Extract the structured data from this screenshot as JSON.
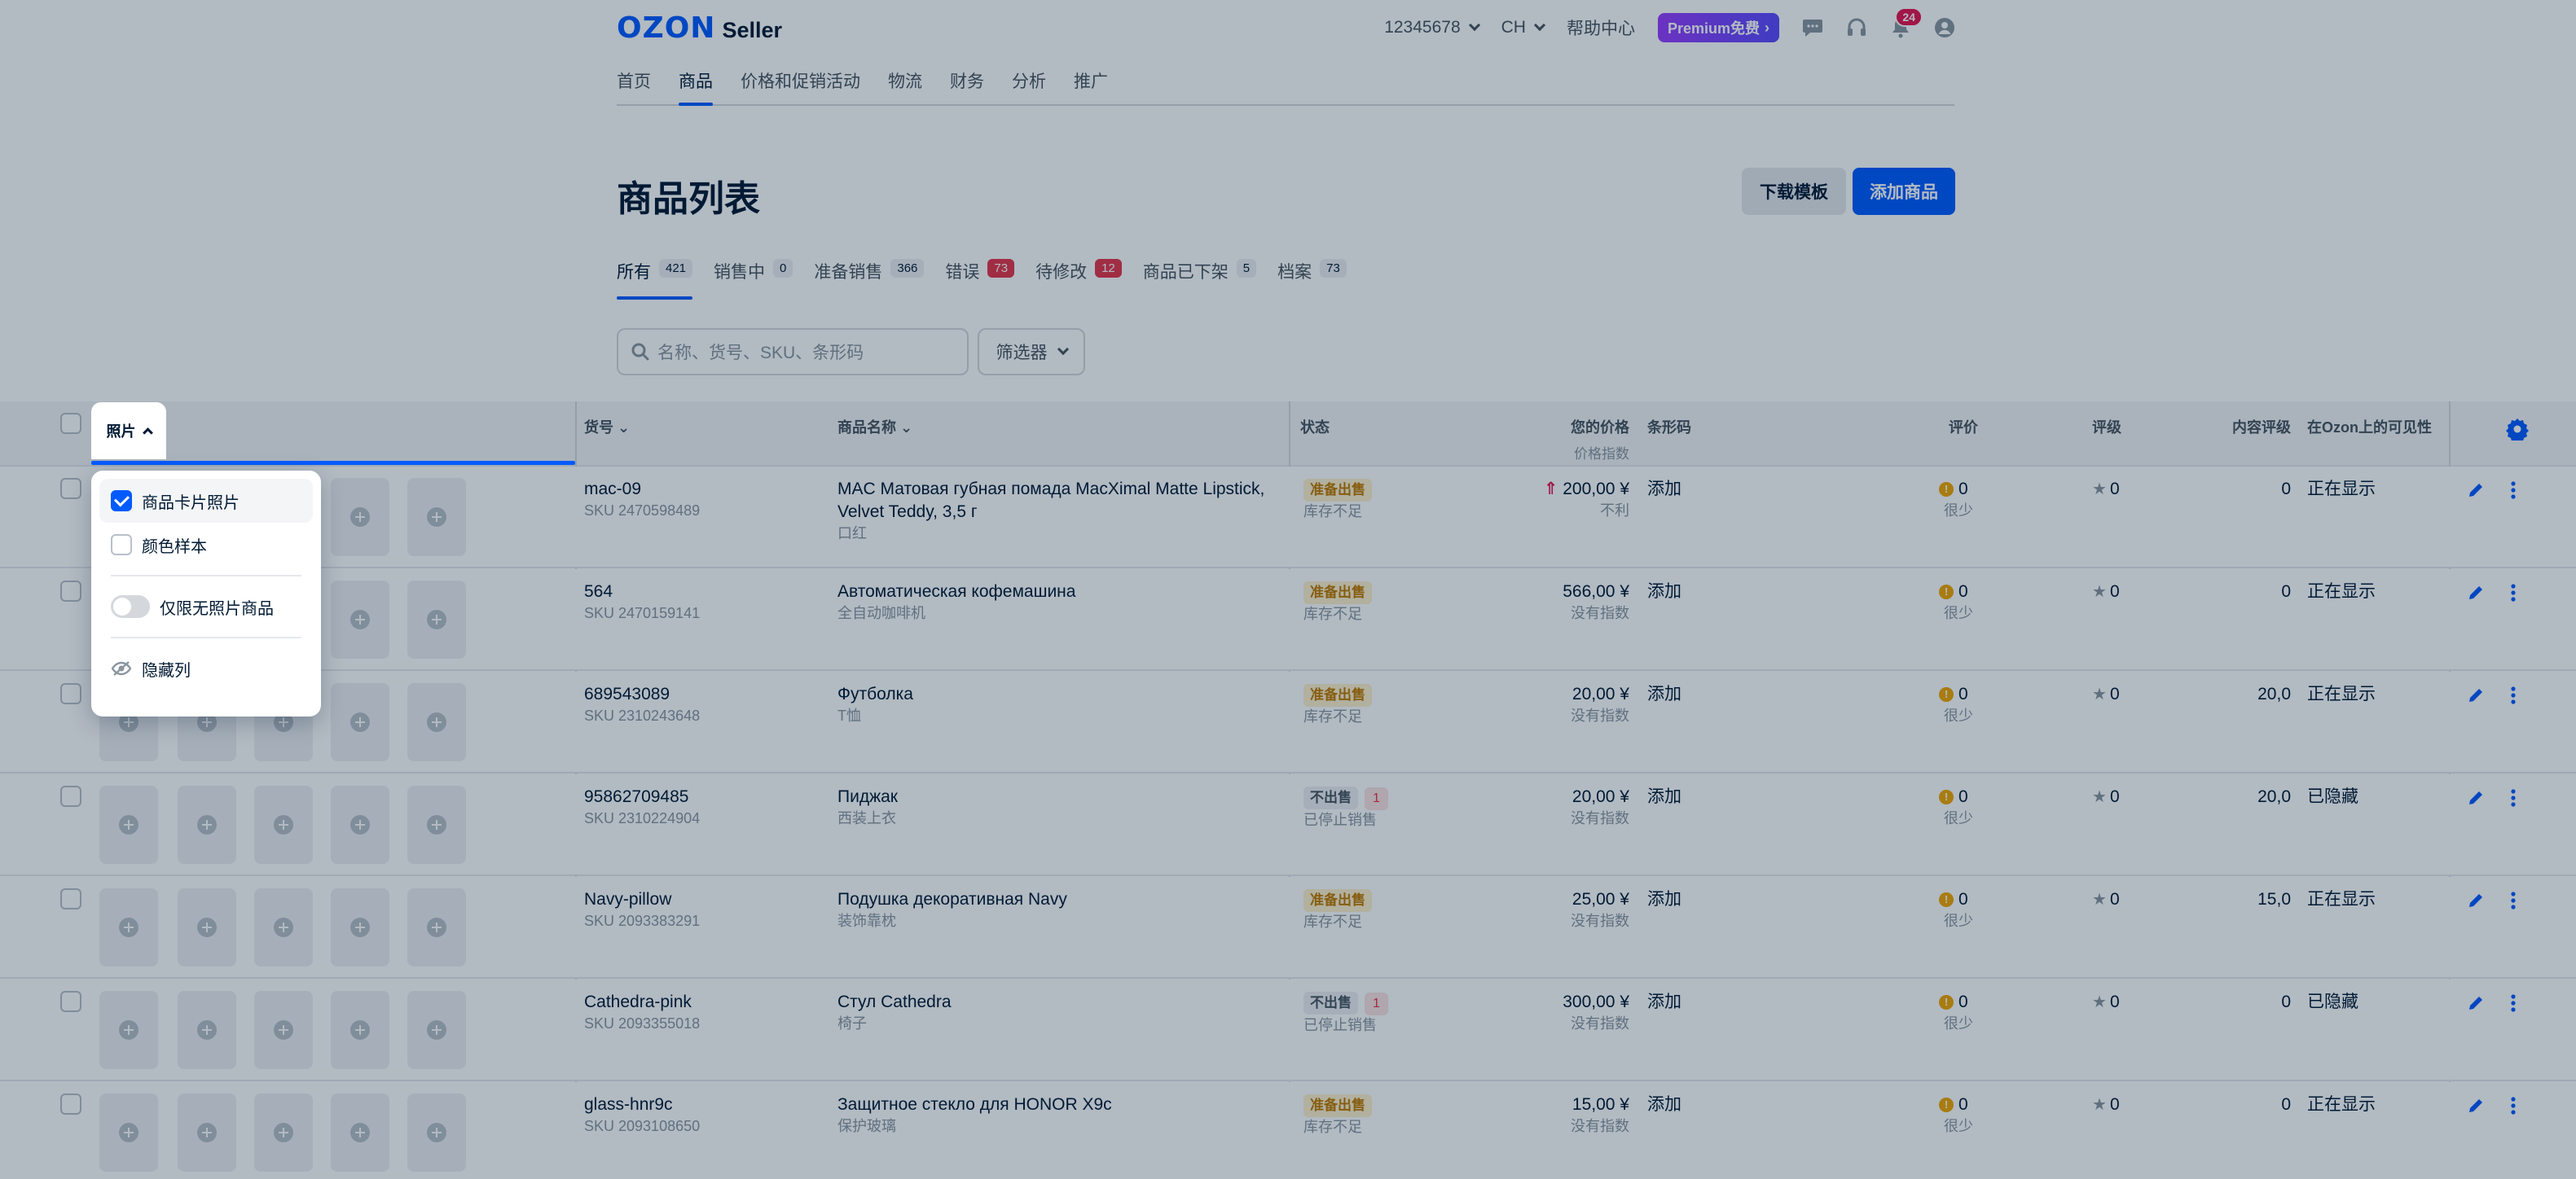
{
  "header": {
    "logo_brand": "OZON",
    "logo_product": "Seller",
    "account_id": "12345678",
    "region": "CH",
    "help": "帮助中心",
    "premium": "Premium免费",
    "notifications_count": "24"
  },
  "nav": [
    "首页",
    "商品",
    "价格和促销活动",
    "物流",
    "财务",
    "分析",
    "推广"
  ],
  "page": {
    "title": "商品列表",
    "download_template": "下载模板",
    "add_product": "添加商品"
  },
  "tabs": [
    {
      "label": "所有",
      "count": "421"
    },
    {
      "label": "销售中",
      "count": "0"
    },
    {
      "label": "准备销售",
      "count": "366"
    },
    {
      "label": "错误",
      "count": "73"
    },
    {
      "label": "待修改",
      "count": "12"
    },
    {
      "label": "商品已下架",
      "count": "5"
    },
    {
      "label": "档案",
      "count": "73"
    }
  ],
  "search": {
    "placeholder": "名称、货号、SKU、条形码",
    "filter": "筛选器"
  },
  "columns": {
    "photo": "照片",
    "sku": "货号",
    "name": "商品名称",
    "status": "状态",
    "price": "您的价格",
    "price_sub": "价格指数",
    "barcode": "条形码",
    "rating": "评价",
    "grade": "评级",
    "content": "内容评级",
    "visibility": "在Ozon上的可见性"
  },
  "dropdown": {
    "card_photo": "商品卡片照片",
    "color_sample": "颜色样本",
    "only_no_photo": "仅限无照片商品",
    "hide_column": "隐藏列"
  },
  "rows": [
    {
      "code": "mac-09",
      "sku": "SKU 2470598489",
      "name": "MAC Матовая губная помада MacXimal Matte Lipstick, Velvet Teddy, 3,5 г",
      "name_cn": "口红",
      "status": "准备出售",
      "status_sub": "库存不足",
      "status_num": "",
      "price": "200,00 ¥",
      "price_index": "不利",
      "barcode": "添加",
      "rating": "0",
      "rating_sub": "很少",
      "grade": "0",
      "content": "0",
      "visibility": "正在显示"
    },
    {
      "code": "564",
      "sku": "SKU 2470159141",
      "name": "Автоматическая кофемашина",
      "name_cn": "全自动咖啡机",
      "status": "准备出售",
      "status_sub": "库存不足",
      "status_num": "",
      "price": "566,00 ¥",
      "price_index": "没有指数",
      "barcode": "添加",
      "rating": "0",
      "rating_sub": "很少",
      "grade": "0",
      "content": "0",
      "visibility": "正在显示"
    },
    {
      "code": "689543089",
      "sku": "SKU 2310243648",
      "name": "Футболка",
      "name_cn": "T恤",
      "status": "准备出售",
      "status_sub": "库存不足",
      "status_num": "",
      "price": "20,00 ¥",
      "price_index": "没有指数",
      "barcode": "添加",
      "rating": "0",
      "rating_sub": "很少",
      "grade": "0",
      "content": "20,0",
      "visibility": "正在显示"
    },
    {
      "code": "95862709485",
      "sku": "SKU 2310224904",
      "name": "Пиджак",
      "name_cn": "西装上衣",
      "status": "不出售",
      "status_sub": "已停止销售",
      "status_num": "1",
      "price": "20,00 ¥",
      "price_index": "没有指数",
      "barcode": "添加",
      "rating": "0",
      "rating_sub": "很少",
      "grade": "0",
      "content": "20,0",
      "visibility": "已隐藏"
    },
    {
      "code": "Navy-pillow",
      "sku": "SKU 2093383291",
      "name": "Подушка декоративная Navy",
      "name_cn": "装饰靠枕",
      "status": "准备出售",
      "status_sub": "库存不足",
      "status_num": "",
      "price": "25,00 ¥",
      "price_index": "没有指数",
      "barcode": "添加",
      "rating": "0",
      "rating_sub": "很少",
      "grade": "0",
      "content": "15,0",
      "visibility": "正在显示"
    },
    {
      "code": "Cathedra-pink",
      "sku": "SKU 2093355018",
      "name": "Стул Cathedra",
      "name_cn": "椅子",
      "status": "不出售",
      "status_sub": "已停止销售",
      "status_num": "1",
      "price": "300,00 ¥",
      "price_index": "没有指数",
      "barcode": "添加",
      "rating": "0",
      "rating_sub": "很少",
      "grade": "0",
      "content": "0",
      "visibility": "已隐藏"
    },
    {
      "code": "glass-hnr9c",
      "sku": "SKU 2093108650",
      "name": "Защитное стекло для HONOR X9c",
      "name_cn": "保护玻璃",
      "status": "准备出售",
      "status_sub": "库存不足",
      "status_num": "",
      "price": "15,00 ¥",
      "price_index": "没有指数",
      "barcode": "添加",
      "rating": "0",
      "rating_sub": "很少",
      "grade": "0",
      "content": "0",
      "visibility": "正在显示"
    }
  ],
  "colors": {
    "accent": "#005bff",
    "warning": "#f2a600",
    "danger": "#e6354a",
    "premium": "#7b3dff"
  }
}
